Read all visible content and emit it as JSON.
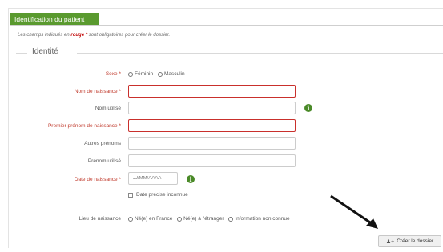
{
  "header": {
    "title": "Identification du patient"
  },
  "note": {
    "before": "Les champs indiqués en ",
    "highlight": "rouge *",
    "after": " sont obligatoires pour créer le dossier."
  },
  "section": {
    "title": "Identité"
  },
  "fields": {
    "sexe": {
      "label": "Sexe *",
      "options": [
        "Féminin",
        "Masculin"
      ]
    },
    "nom_naissance": {
      "label": "Nom de naissance *",
      "value": ""
    },
    "nom_utilise": {
      "label": "Nom utilisé",
      "value": ""
    },
    "premier_prenom": {
      "label": "Premier prénom de naissance *",
      "value": ""
    },
    "autres_prenoms": {
      "label": "Autres prénoms",
      "value": ""
    },
    "prenom_utilise": {
      "label": "Prénom utilisé",
      "value": ""
    },
    "date_naissance": {
      "label": "Date de naissance *",
      "placeholder": "JJ/MM/AAAA",
      "value": ""
    },
    "date_precise": {
      "label": "Date précise inconnue"
    },
    "lieu_naissance": {
      "label": "Lieu de naissance",
      "options": [
        "Né(e) en France",
        "Né(e) à l'étranger",
        "Information non connue"
      ]
    }
  },
  "icons": {
    "info": "info-icon",
    "create": "user-plus-icon"
  },
  "actions": {
    "create_label": "Créer le dossier"
  },
  "colors": {
    "header_green": "#5a9a2f",
    "required_red": "#c9302c",
    "info_green": "#4a8a28"
  }
}
